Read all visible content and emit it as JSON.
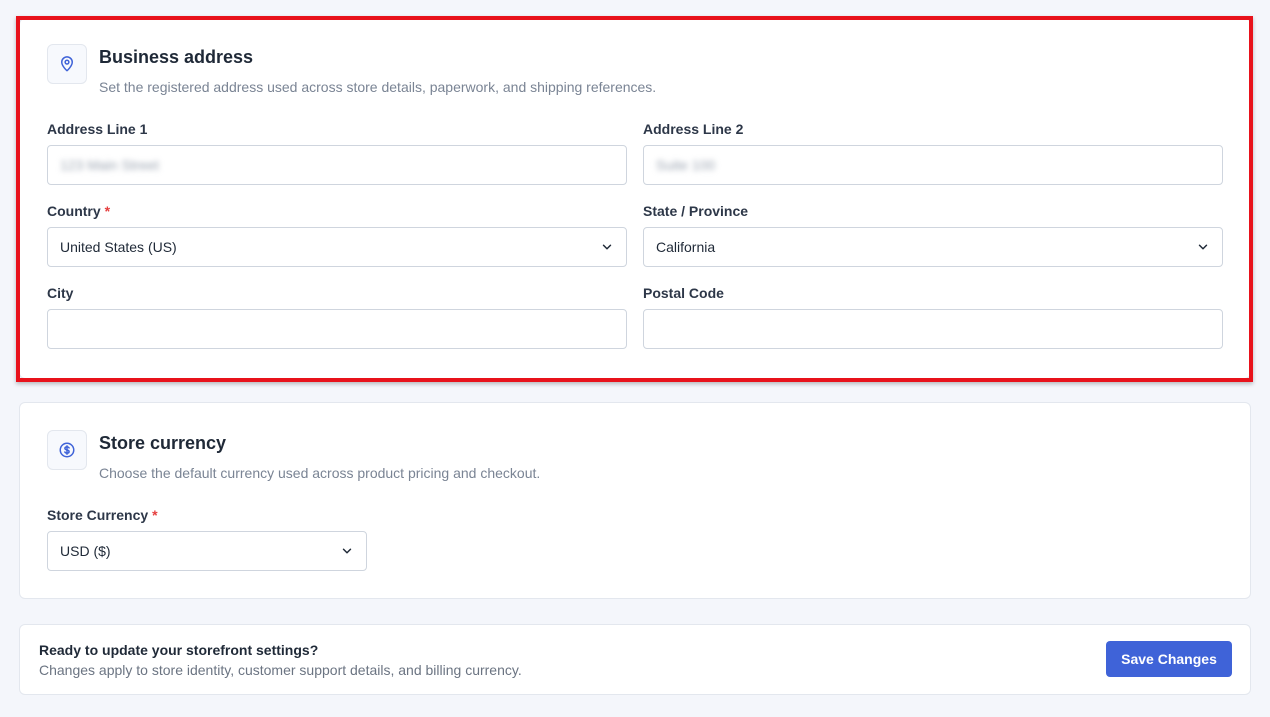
{
  "address": {
    "title": "Business address",
    "description": "Set the registered address used across store details, paperwork, and shipping references.",
    "icon": "map-pin-icon",
    "address_line1": {
      "label": "Address Line 1",
      "value": "123 Main Street"
    },
    "address_line2": {
      "label": "Address Line 2",
      "value": "Suite 100"
    },
    "country": {
      "label": "Country",
      "required_mark": "*",
      "value": "United States (US)"
    },
    "state": {
      "label": "State / Province",
      "value": "California"
    },
    "city": {
      "label": "City",
      "value": ""
    },
    "postal": {
      "label": "Postal Code",
      "value": ""
    }
  },
  "currency": {
    "title": "Store currency",
    "description": "Choose the default currency used across product pricing and checkout.",
    "icon": "dollar-icon",
    "store_currency": {
      "label": "Store Currency",
      "required_mark": "*",
      "value": "USD ($)"
    }
  },
  "footer": {
    "title": "Ready to update your storefront settings?",
    "description": "Changes apply to store identity, customer support details, and billing currency.",
    "save_label": "Save Changes"
  },
  "colors": {
    "accent": "#3f63d8",
    "highlight": "#e8121b",
    "required": "#e53e3e"
  }
}
